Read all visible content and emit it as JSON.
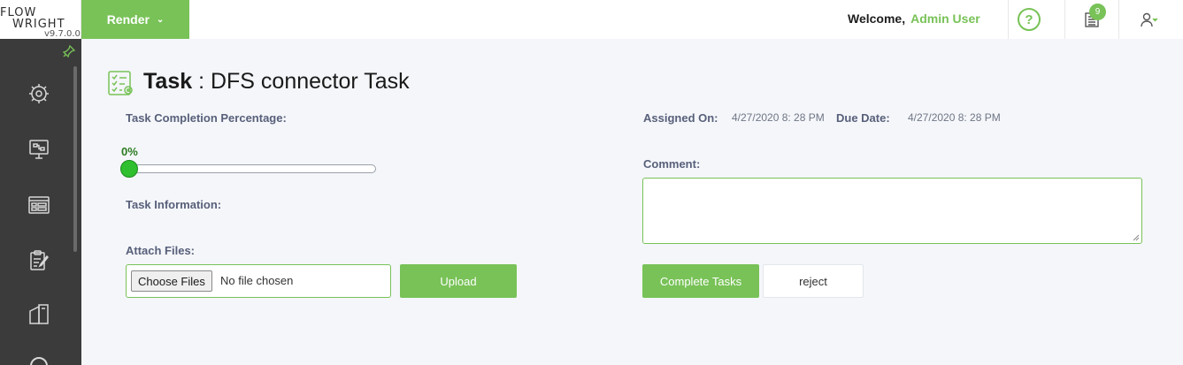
{
  "brand": {
    "logo_line1": "FLOW",
    "logo_line2": "WRIGHT",
    "version": "v9.7.0.0"
  },
  "sidebar": {
    "items": [
      {
        "icon": "process-gear-icon"
      },
      {
        "icon": "monitor-workflow-icon"
      },
      {
        "icon": "dashboard-grid-icon"
      },
      {
        "icon": "clipboard-edit-icon"
      },
      {
        "icon": "forms-icon"
      },
      {
        "icon": "refresh-icon"
      }
    ]
  },
  "topbar": {
    "render_label": "Render",
    "welcome_label": "Welcome,",
    "user_name": "Admin User",
    "help_label": "?",
    "task_badge_count": "9"
  },
  "task": {
    "title_prefix": "Task",
    "title_separator": " : ",
    "title_name": "DFS connector Task",
    "completion_label": "Task Completion Percentage:",
    "completion_value": "0%",
    "completion_fraction": 0,
    "information_label": "Task Information:",
    "attach_label": "Attach Files:",
    "choose_files_label": "Choose Files",
    "no_file_text": "No file chosen",
    "upload_label": "Upload",
    "assigned_on_label": "Assigned On:",
    "assigned_on_value": "4/27/2020 8: 28 PM",
    "due_date_label": "Due Date:",
    "due_date_value": "4/27/2020 8: 28 PM",
    "comment_label": "Comment:",
    "comment_value": "",
    "complete_label": "Complete Tasks",
    "reject_label": "reject"
  },
  "colors": {
    "accent": "#78c257",
    "sidebar_bg": "#3b3b3b",
    "page_bg": "#f4f6fa",
    "label": "#58607a",
    "slider_thumb": "#2fbf2f"
  }
}
